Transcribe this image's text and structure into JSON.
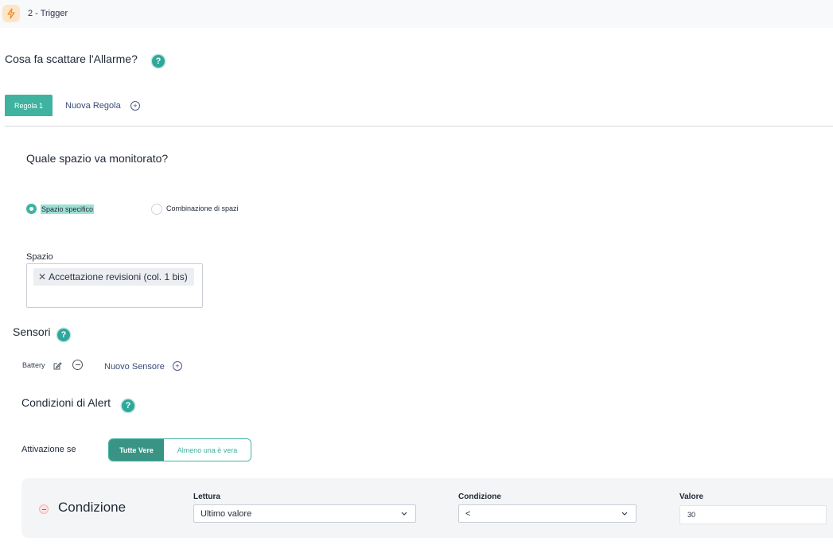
{
  "header": {
    "step_title": "2 - Trigger",
    "icon": "lightning-icon"
  },
  "question_trigger": "Cosa fa scattare l'Allarme?",
  "help_glyph": "?",
  "tabs": {
    "active_label": "Regola 1",
    "new_label": "Nuova Regola"
  },
  "space_section": {
    "question": "Quale spazio va monitorato?",
    "options": [
      {
        "label": "Spazio specifico",
        "selected": true
      },
      {
        "label": "Combinazione di spazi",
        "selected": false
      }
    ],
    "field_label": "Spazio",
    "selected_tag": "Accettazione revisioni (col. 1 bis)"
  },
  "sensors": {
    "title": "Sensori",
    "item": "Battery",
    "new_label": "Nuovo Sensore"
  },
  "alert_conditions": {
    "title": "Condizioni di Alert",
    "activation_label": "Attivazione se",
    "toggle": {
      "all_label": "Tutte Vere",
      "any_label": "Almeno una è vera",
      "active": "all"
    }
  },
  "condition_card": {
    "title": "Condizione",
    "reading_label": "Lettura",
    "reading_value": "Ultimo valore",
    "condition_label": "Condizione",
    "condition_value": "<",
    "value_label": "Valore",
    "value": "30"
  },
  "colors": {
    "accent": "#3fb3a0",
    "accent_dark": "#3a9485",
    "link": "#3b4a7a",
    "danger": "#e04848"
  }
}
